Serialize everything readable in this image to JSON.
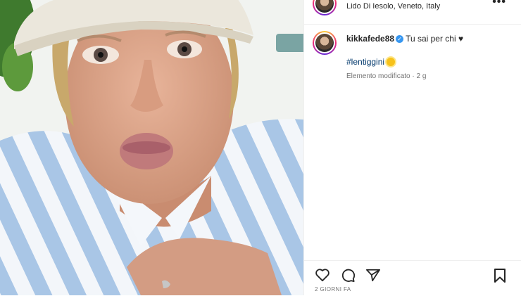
{
  "post": {
    "location": "Lido Di Iesolo, Veneto, Italy",
    "more_icon": "more-horizontal-icon",
    "caption": {
      "username": "kikkafede88",
      "verified_icon": "verified-badge-icon",
      "text": "Tu sai per chi ♥",
      "hashtag": "#lentiggini",
      "hashtag_icon": "sun-emoji-icon",
      "edited": "Elemento modificato · 2 g"
    },
    "actions": {
      "like_icon": "heart-icon",
      "comment_icon": "comment-icon",
      "share_icon": "share-icon",
      "save_icon": "bookmark-icon"
    },
    "timestamp": "2 GIORNI FA"
  },
  "colors": {
    "link": "#00376b",
    "verified": "#3897f0",
    "muted": "#737373",
    "shirt_stripe": "#a9c6e6"
  }
}
